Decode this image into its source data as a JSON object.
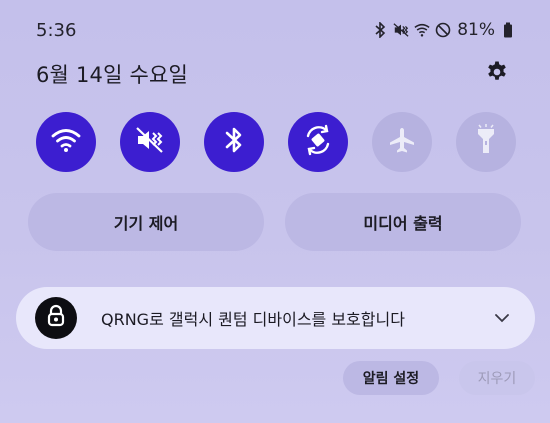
{
  "status_bar": {
    "time": "5:36",
    "battery_percent": "81%",
    "icons": [
      "bluetooth-icon",
      "vibrate-mute-icon",
      "wifi-icon",
      "do-not-disturb-icon",
      "battery-icon"
    ]
  },
  "header": {
    "date": "6월 14일 수요일",
    "settings_icon": "gear-icon"
  },
  "quick_toggles": [
    {
      "name": "wifi",
      "icon": "wifi-icon",
      "state": "on"
    },
    {
      "name": "sound",
      "icon": "mute-icon",
      "state": "on"
    },
    {
      "name": "bluetooth",
      "icon": "bluetooth-icon",
      "state": "on"
    },
    {
      "name": "auto-rotate",
      "icon": "rotate-icon",
      "state": "on"
    },
    {
      "name": "airplane-mode",
      "icon": "airplane-icon",
      "state": "off"
    },
    {
      "name": "flashlight",
      "icon": "flashlight-icon",
      "state": "off"
    }
  ],
  "controls": {
    "device_control_label": "기기 제어",
    "media_output_label": "미디어 출력"
  },
  "notification": {
    "text": "QRNG로 갤럭시 퀀텀 디바이스를 보호합니다",
    "icon": "lock-icon"
  },
  "actions": {
    "notification_settings_label": "알림 설정",
    "clear_label": "지우기"
  },
  "colors": {
    "accent": "#3c1ed0",
    "background": "#c6c2ec",
    "toggle_off": "#b6b2e0"
  }
}
